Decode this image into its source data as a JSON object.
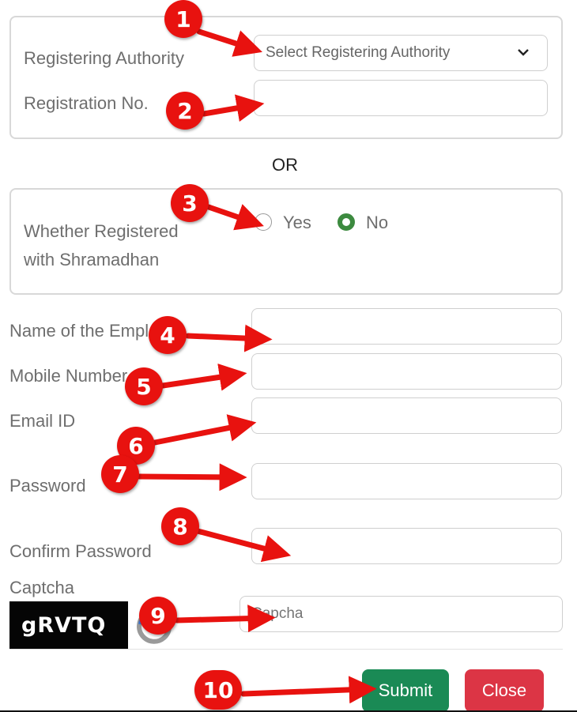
{
  "colors": {
    "accent_radio": "#3c8a3f",
    "submit": "#1a8a55",
    "close": "#dc3545",
    "annotation": "#e8120f"
  },
  "section1": {
    "authority_label": "Registering Authority",
    "authority_select_value": "Select Registering Authority",
    "regno_label": "Registration No.",
    "regno_value": ""
  },
  "separator": "OR",
  "section2": {
    "question_line1": "Whether Registered",
    "question_line2": "with Shramadhan",
    "options": [
      {
        "label": "Yes",
        "checked": false
      },
      {
        "label": "No",
        "checked": true
      }
    ]
  },
  "form": {
    "employer_label": "Name of the Employer",
    "mobile_label": "Mobile Number",
    "email_label": "Email ID",
    "password_label": "Password",
    "confirm_label": "Confirm Password",
    "captcha_label": "Captcha",
    "captcha_image_text": "gRVTQ",
    "captcha_placeholder": "Capcha"
  },
  "buttons": {
    "submit": "Submit",
    "close": "Close"
  },
  "annotations": [
    "1",
    "2",
    "3",
    "4",
    "5",
    "6",
    "7",
    "8",
    "9",
    "10"
  ],
  "icons": {
    "select_chevron": "chevron-down-icon",
    "refresh": "refresh-icon",
    "arrow": "arrow-right-icon"
  }
}
